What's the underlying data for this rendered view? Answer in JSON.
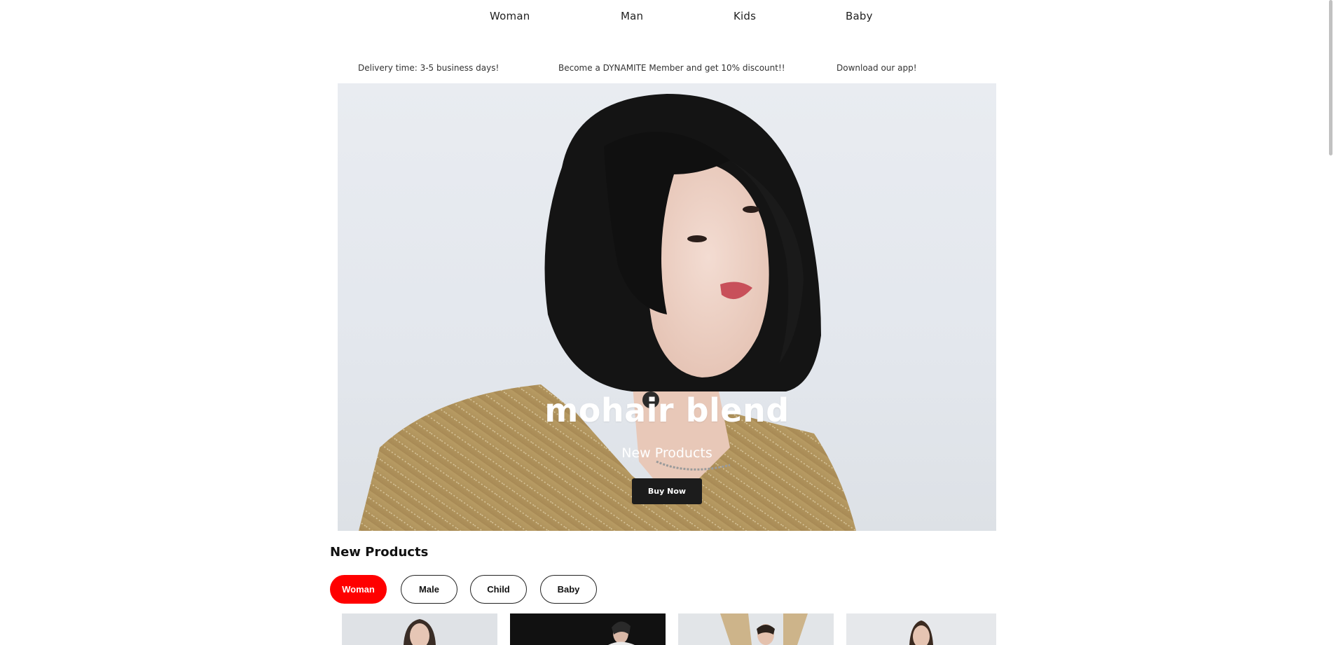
{
  "nav": {
    "items": [
      "Woman",
      "Man",
      "Kids",
      "Baby"
    ]
  },
  "announcements": [
    "Delivery time: 3-5 business days!",
    "Become a DYNAMITE Member and get 10% discount!!",
    "Download our app!"
  ],
  "hero": {
    "title": "mohair blend",
    "subtitle": "New Products",
    "button_label": "Buy Now"
  },
  "products_section": {
    "title": "New Products",
    "filters": [
      {
        "label": "Woman",
        "active": true
      },
      {
        "label": "Male",
        "active": false
      },
      {
        "label": "Child",
        "active": false
      },
      {
        "label": "Baby",
        "active": false
      }
    ]
  },
  "colors": {
    "accent": "#ff0000",
    "button_dark": "#1c1c1c",
    "text": "#111111"
  }
}
